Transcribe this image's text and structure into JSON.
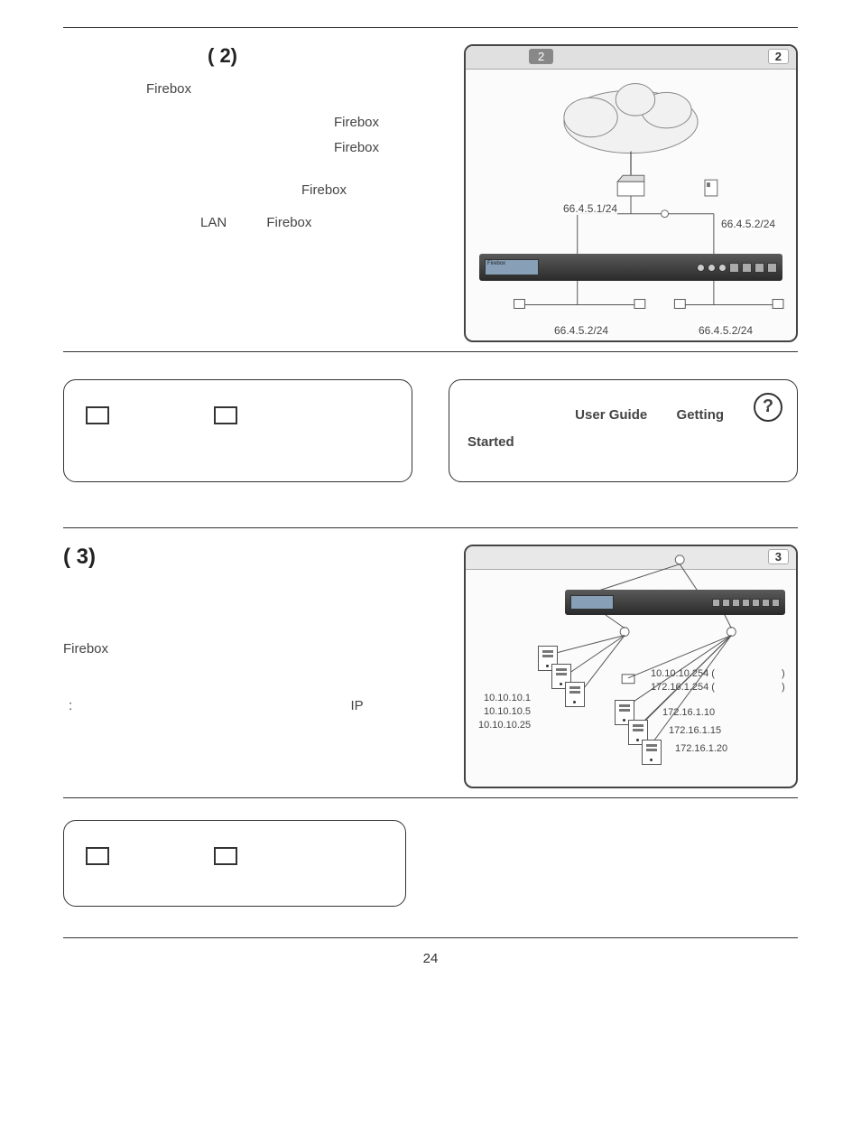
{
  "page_number": "24",
  "section2": {
    "heading": "( 2)",
    "line1": "Firebox",
    "line2a": "Firebox",
    "line2b": "Firebox",
    "line3": "Firebox",
    "line4a": "LAN",
    "line4b": "Firebox",
    "diagram": {
      "badge_small": "2",
      "badge_right": "2",
      "ip_left": "66.4.5.1/24",
      "ip_right": "66.4.5.2/24",
      "ip_bottom_left": "66.4.5.2/24",
      "ip_bottom_right": "66.4.5.2/24"
    }
  },
  "card_left_1": {
    "label": ""
  },
  "card_right_1": {
    "user_guide": "User Guide",
    "getting": "Getting",
    "started": "Started"
  },
  "section3": {
    "heading": "( 3)",
    "firebox": "Firebox",
    "colon": ":",
    "ip_label": "IP",
    "diagram": {
      "badge": "3",
      "left_ip1": "10.10.10.1",
      "left_ip2": "10.10.10.5",
      "left_ip3": "10.10.10.25",
      "right_top1": "10.10.10.254 (",
      "right_top1_end": ")",
      "right_top2": "172.16.1.254 (",
      "right_top2_end": ")",
      "right_ip1": "172.16.1.10",
      "right_ip2": "172.16.1.15",
      "right_ip3": "172.16.1.20"
    }
  },
  "card_left_2": {
    "label": ""
  }
}
